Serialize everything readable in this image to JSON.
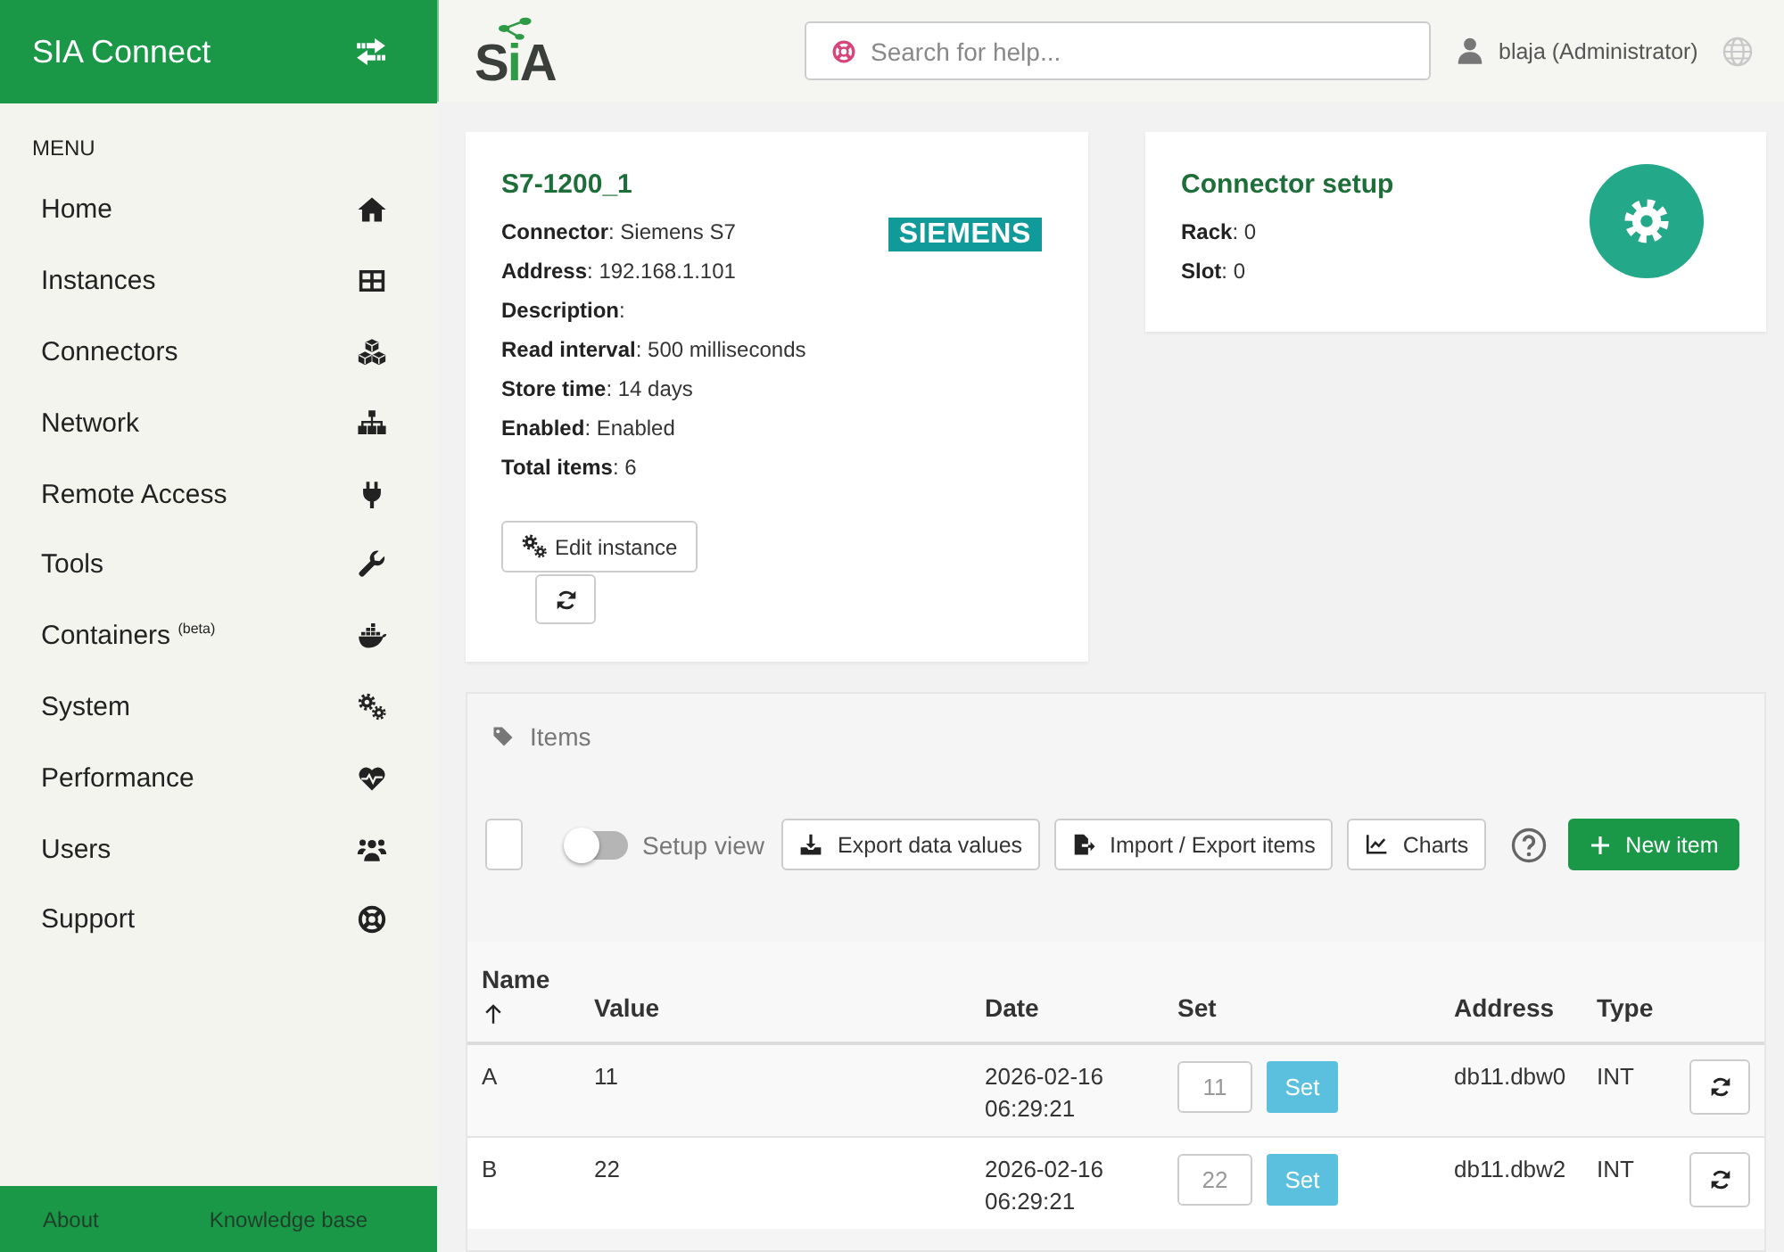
{
  "sidebar": {
    "title": "SIA Connect",
    "menu_heading": "MENU",
    "items": [
      {
        "label": "Home"
      },
      {
        "label": "Instances"
      },
      {
        "label": "Connectors"
      },
      {
        "label": "Network"
      },
      {
        "label": "Remote Access"
      },
      {
        "label": "Tools"
      },
      {
        "label": "Containers $^{(beta)}$"
      },
      {
        "label": "System"
      },
      {
        "label": "Performance"
      },
      {
        "label": "Users"
      },
      {
        "label": "Support"
      }
    ],
    "footer_links": [
      "About",
      "Knowledge base"
    ]
  },
  "header": {
    "logo_text": "SiA",
    "search": {
      "placeholder": "Search for help..."
    },
    "user": "blaja (Administrator)"
  },
  "instance": {
    "title": "S7-1200_1",
    "brand": "SIEMENS",
    "details": [
      "**Connector**: Siemens S7",
      "**Address**: 192.168.1.101",
      "**Description**:",
      "**Read interval**: 500 milliseconds",
      "**Store time**: 14 days",
      "**Enabled**: Enabled",
      "**Total items**: 6"
    ],
    "edit_button": "Edit instance"
  },
  "connector_setup": {
    "title": "Connector setup",
    "details": [
      "**Rack**: 0",
      "**Slot**: 0"
    ]
  },
  "items_panel": {
    "title": "Items",
    "setup_view": {
      "label": "Setup view",
      "on": false
    },
    "buttons": [
      {
        "label": "Export data values"
      },
      {
        "label": "Import / Export items"
      },
      {
        "label": "Charts"
      }
    ],
    "new_item_button": "New item",
    "table": {
      "columns": [
        {
          "label": "Name",
          "sorted": true
        },
        {
          "label": "Value",
          "sorted": false
        },
        {
          "label": "Date",
          "sorted": false
        },
        {
          "label": "Set",
          "sorted": false
        },
        {
          "label": "Address",
          "sorted": false
        },
        {
          "label": "Type",
          "sorted": false
        }
      ],
      "rows": [
        {
          "name": "A",
          "value": "11",
          "date": "2026-02-16 06:29:21",
          "set": {
            "placeholder": "11",
            "button": "Set"
          },
          "address": "db11.dbw0",
          "type": "INT"
        },
        {
          "name": "B",
          "value": "22",
          "date": "2026-02-16 06:29:21",
          "set": {
            "placeholder": "22",
            "button": "Set"
          },
          "address": "db11.dbw2",
          "type": "INT"
        }
      ]
    }
  }
}
